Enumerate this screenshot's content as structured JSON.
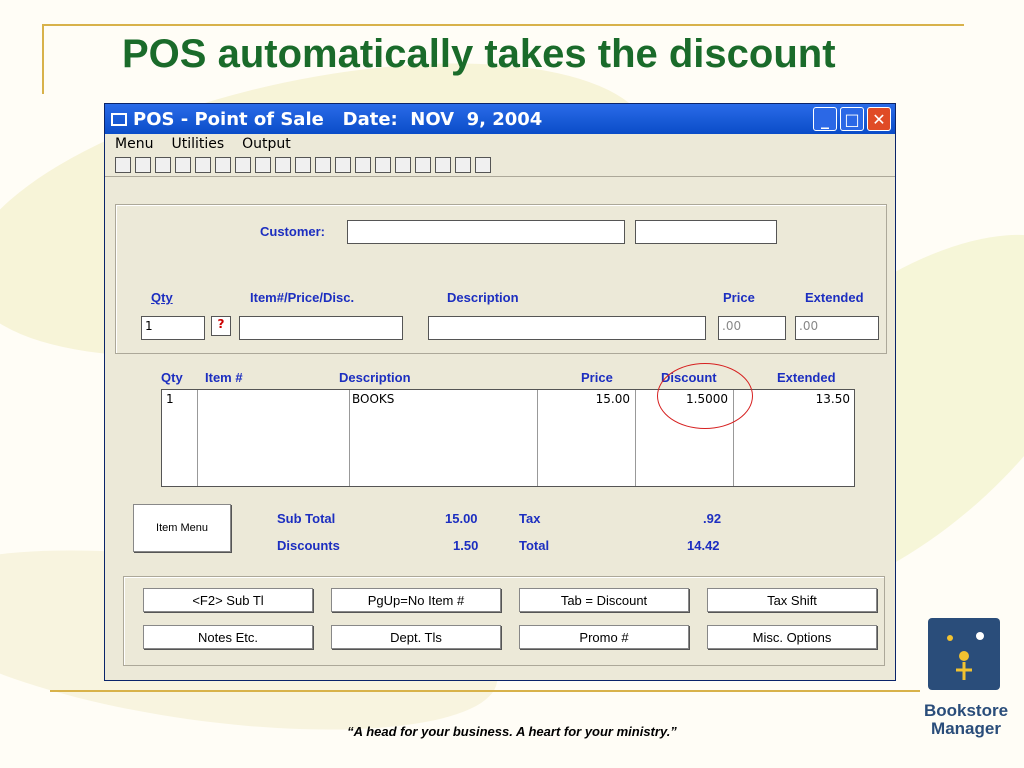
{
  "slide": {
    "title": "POS automatically takes the discount",
    "footer": "“A head for your business. A heart for your ministry.”",
    "logo_text": "Bookstore Manager"
  },
  "window": {
    "title": "POS - Point of Sale   Date:  NOV  9, 2004",
    "menu": [
      "Menu",
      "Utilities",
      "Output"
    ],
    "toolbar_icons": [
      "calculator-icon",
      "edit-icon",
      "print-icon",
      "clock-icon",
      "calendar-icon",
      "phone-icon",
      "stamp-icon",
      "binoculars-icon",
      "network-icon",
      "glasses-icon",
      "barcode-icon",
      "bomb-icon",
      "lock-icon",
      "card-icon",
      "chart-icon",
      "screen-icon",
      "tbo-icon",
      "help-h-icon",
      "question-icon"
    ]
  },
  "form": {
    "customer_label": "Customer:",
    "qty_label": "Qty",
    "item_label": "Item#/Price/Disc.",
    "description_label": "Description",
    "price_label": "Price",
    "extended_label": "Extended",
    "qty_value": "1",
    "help_btn": "?",
    "price_value": ".00",
    "extended_value": ".00"
  },
  "grid": {
    "headers": [
      "Qty",
      "Item #",
      "Description",
      "Price",
      "Discount",
      "Extended"
    ],
    "rows": [
      [
        "1",
        "",
        "BOOKS",
        "15.00",
        "1.5000",
        "13.50"
      ]
    ]
  },
  "totals": {
    "item_menu": "Item Menu",
    "sub_total_label": "Sub Total",
    "sub_total": "15.00",
    "discounts_label": "Discounts",
    "discounts": "1.50",
    "tax_label": "Tax",
    "tax": ".92",
    "total_label": "Total",
    "total": "14.42"
  },
  "buttons": [
    "<F2> Sub Tl",
    "PgUp=No Item #",
    "Tab = Discount",
    "Tax Shift",
    "Notes Etc.",
    "Dept. Tls",
    "Promo #",
    "Misc. Options"
  ]
}
